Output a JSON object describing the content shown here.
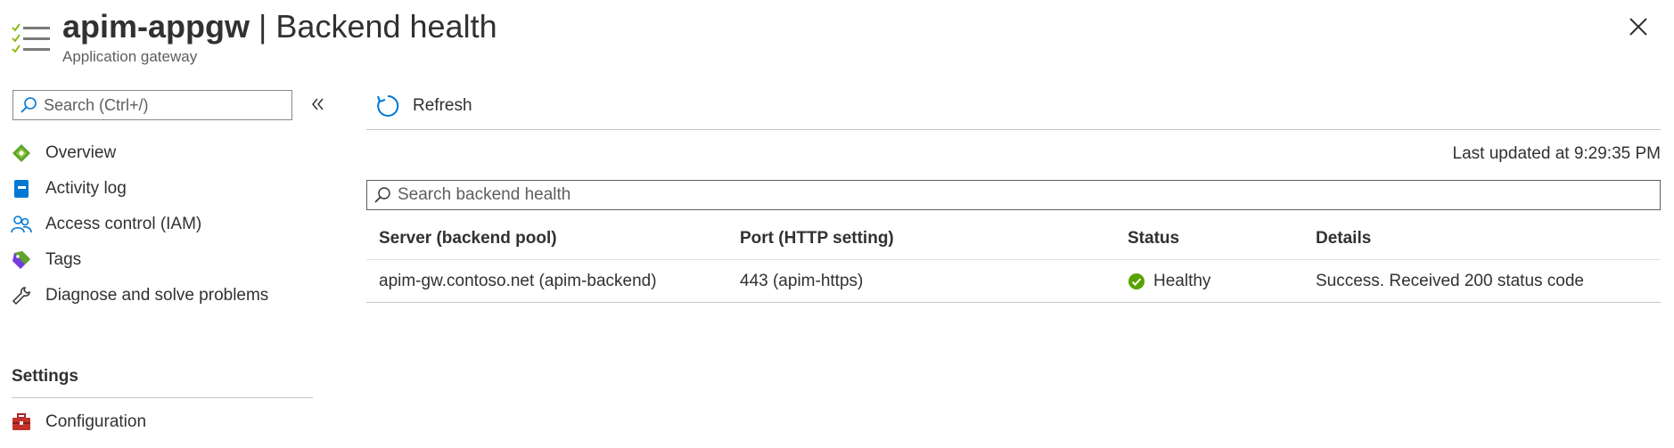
{
  "header": {
    "resource_name": "apim-appgw",
    "separator": "|",
    "page_name": "Backend health",
    "subtitle": "Application gateway",
    "icons": {
      "resource": "app-gateway-list-icon",
      "close": "close-icon"
    }
  },
  "sidebar": {
    "search_placeholder": "Search (Ctrl+/)",
    "collapse_icon": "double-chevron-left-icon",
    "items": [
      {
        "label": "Overview",
        "icon": "overview-icon"
      },
      {
        "label": "Activity log",
        "icon": "activity-log-icon"
      },
      {
        "label": "Access control (IAM)",
        "icon": "people-icon"
      },
      {
        "label": "Tags",
        "icon": "tag-icon"
      },
      {
        "label": "Diagnose and solve problems",
        "icon": "wrench-icon"
      }
    ],
    "section_title": "Settings",
    "settings_items": [
      {
        "label": "Configuration",
        "icon": "toolbox-icon"
      }
    ]
  },
  "toolbar": {
    "refresh_label": "Refresh",
    "refresh_icon": "refresh-icon"
  },
  "main": {
    "last_updated": "Last updated at 9:29:35 PM",
    "search_placeholder": "Search backend health",
    "columns": [
      "Server (backend pool)",
      "Port (HTTP setting)",
      "Status",
      "Details"
    ],
    "rows": [
      {
        "server": "apim-gw.contoso.net (apim-backend)",
        "port": "443 (apim-https)",
        "status": "Healthy",
        "status_icon": "check-circle-icon",
        "details": "Success. Received 200 status code"
      }
    ]
  },
  "colors": {
    "accent": "#0078d4",
    "healthy": "#57a300",
    "text": "#323130",
    "muted": "#605e5c",
    "divider": "#c8c6c4"
  }
}
